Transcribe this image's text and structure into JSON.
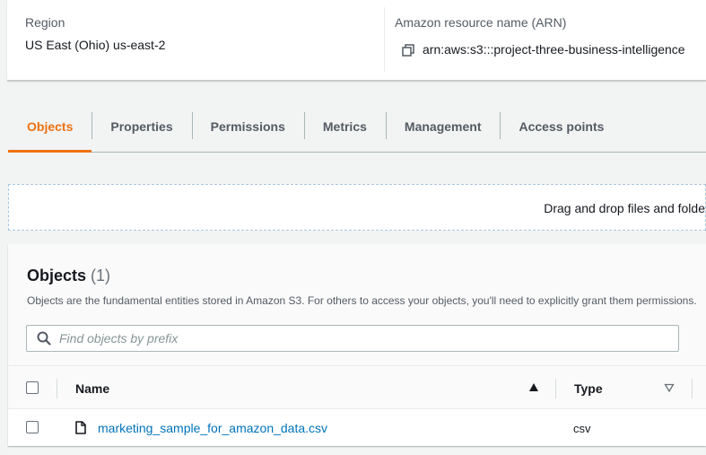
{
  "details": {
    "region_label": "Region",
    "region_value": "US East (Ohio) us-east-2",
    "arn_label": "Amazon resource name (ARN)",
    "arn_value": "arn:aws:s3:::project-three-business-intelligence",
    "copy_icon": "copy-icon"
  },
  "tabs": [
    {
      "label": "Objects",
      "active": true
    },
    {
      "label": "Properties",
      "active": false
    },
    {
      "label": "Permissions",
      "active": false
    },
    {
      "label": "Metrics",
      "active": false
    },
    {
      "label": "Management",
      "active": false
    },
    {
      "label": "Access points",
      "active": false
    }
  ],
  "dropzone": {
    "text": "Drag and drop files and folde"
  },
  "objects": {
    "title": "Objects",
    "count": "(1)",
    "description": "Objects are the fundamental entities stored in Amazon S3. For others to access your objects, you'll need to explicitly grant them permissions.",
    "search_placeholder": "Find objects by prefix",
    "search_value": "",
    "columns": {
      "name": "Name",
      "type": "Type"
    },
    "rows": [
      {
        "name": "marketing_sample_for_amazon_data.csv",
        "type": "csv",
        "icon": "file-icon"
      }
    ]
  },
  "colors": {
    "accent": "#ec7211",
    "link": "#0073bb"
  }
}
